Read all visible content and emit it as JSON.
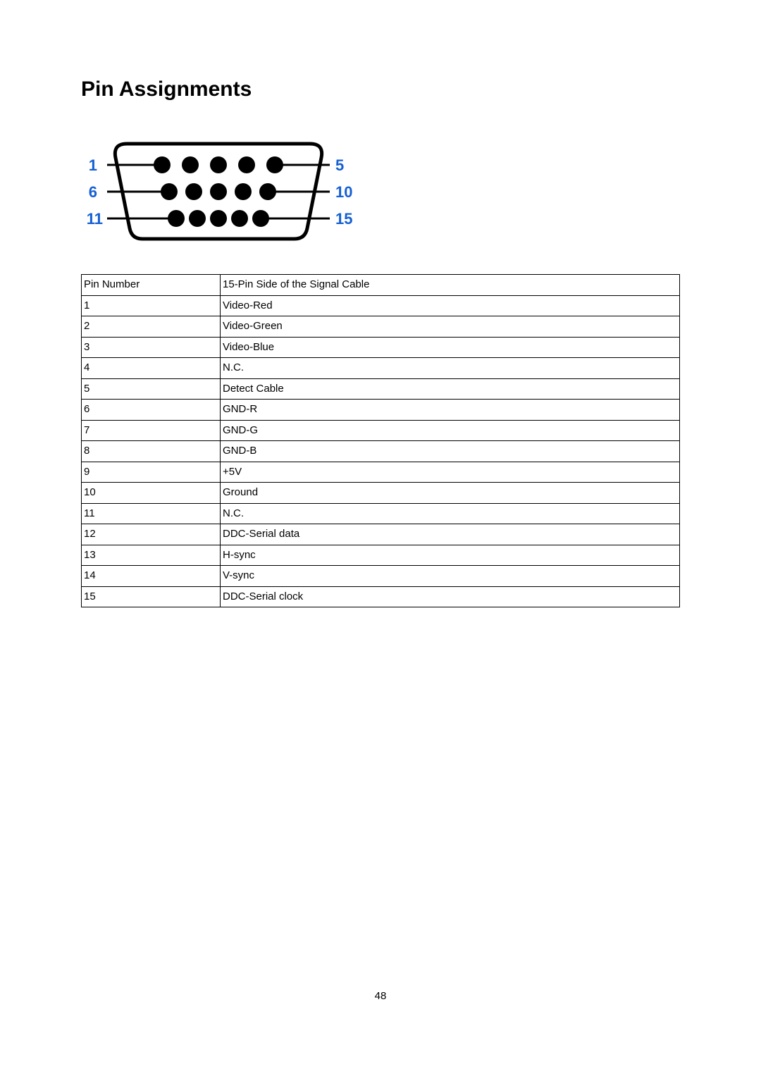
{
  "title": "Pin Assignments",
  "diagram": {
    "left_labels": [
      "1",
      "6",
      "11"
    ],
    "right_labels": [
      "5",
      "10",
      "15"
    ]
  },
  "table": {
    "header": {
      "col1": "Pin Number",
      "col2": "15-Pin Side of the Signal Cable"
    },
    "rows": [
      {
        "num": "1",
        "desc": "Video-Red"
      },
      {
        "num": "2",
        "desc": "Video-Green"
      },
      {
        "num": "3",
        "desc": "Video-Blue"
      },
      {
        "num": "4",
        "desc": "N.C."
      },
      {
        "num": "5",
        "desc": "Detect Cable"
      },
      {
        "num": "6",
        "desc": "GND-R"
      },
      {
        "num": "7",
        "desc": "GND-G"
      },
      {
        "num": "8",
        "desc": "GND-B"
      },
      {
        "num": "9",
        "desc": "+5V"
      },
      {
        "num": "10",
        "desc": "Ground"
      },
      {
        "num": "11",
        "desc": "N.C."
      },
      {
        "num": "12",
        "desc": "DDC-Serial data"
      },
      {
        "num": "13",
        "desc": "H-sync"
      },
      {
        "num": "14",
        "desc": "V-sync"
      },
      {
        "num": "15",
        "desc": "DDC-Serial clock"
      }
    ]
  },
  "page_number": "48"
}
